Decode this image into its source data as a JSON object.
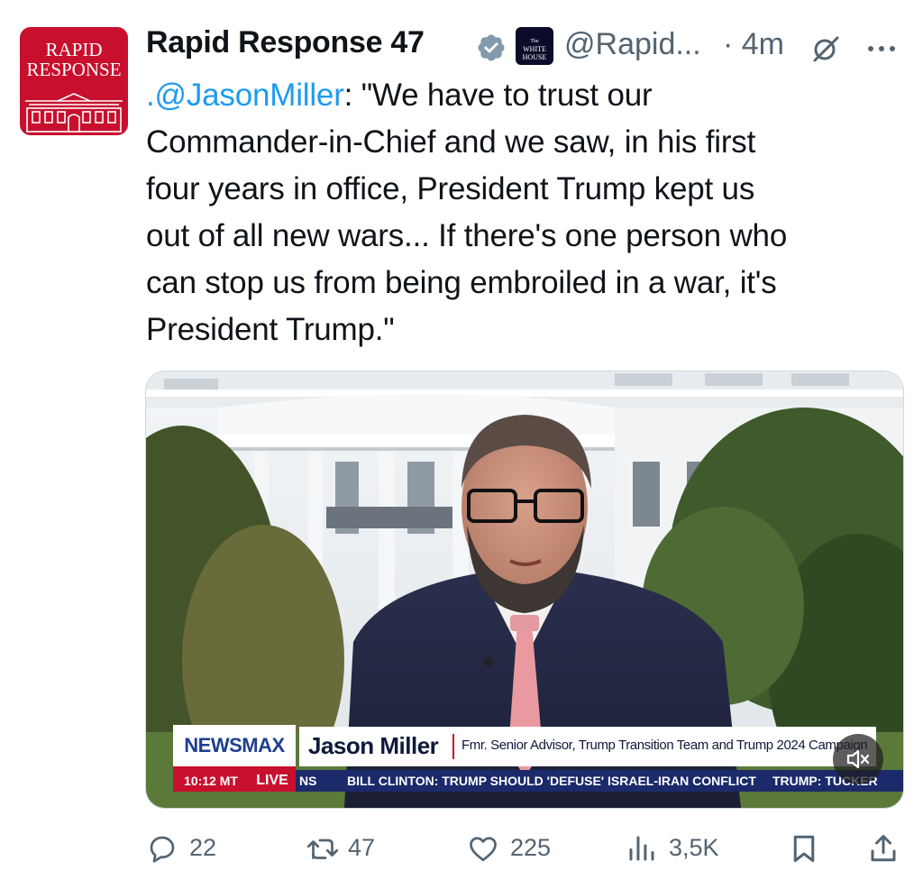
{
  "avatar": {
    "text_line1": "RAPID",
    "text_line2": "RESPONSE",
    "bg_color": "#c8102e"
  },
  "author": {
    "name": "Rapid Response 47",
    "handle": "@Rapid...",
    "time": "· 4m",
    "affiliation_badge_line1": "The",
    "affiliation_badge_line2": "WHITE",
    "affiliation_badge_line3": "HOUSE",
    "verified_color": "#829aab"
  },
  "tweet": {
    "mention": ".@JasonMiller",
    "body": ": \"We have to trust our\nCommander-in-Chief and we saw, in his first\nfour years in office, President Trump kept us\nout of all new wars... If there's one person who\ncan stop us from being embroiled in a war, it's\nPresident Trump.\"",
    "mention_color": "#1d9bf0"
  },
  "media": {
    "network": "NEWSMAX",
    "lower_third_name": "Jason Miller",
    "lower_third_title": "Fmr. Senior Advisor, Trump Transition Team and Trump 2024 Campaign",
    "ticker_time": "10:12 MT",
    "ticker_live": "LIVE",
    "ticker_prefix": "NS",
    "ticker_headline": "BILL CLINTON: TRUMP SHOULD 'DEFUSE' ISRAEL-IRAN CONFLICT",
    "ticker_next": "TRUMP: TUCKER"
  },
  "actions": {
    "replies": "22",
    "reposts": "47",
    "likes": "225",
    "views": "3,5K"
  }
}
